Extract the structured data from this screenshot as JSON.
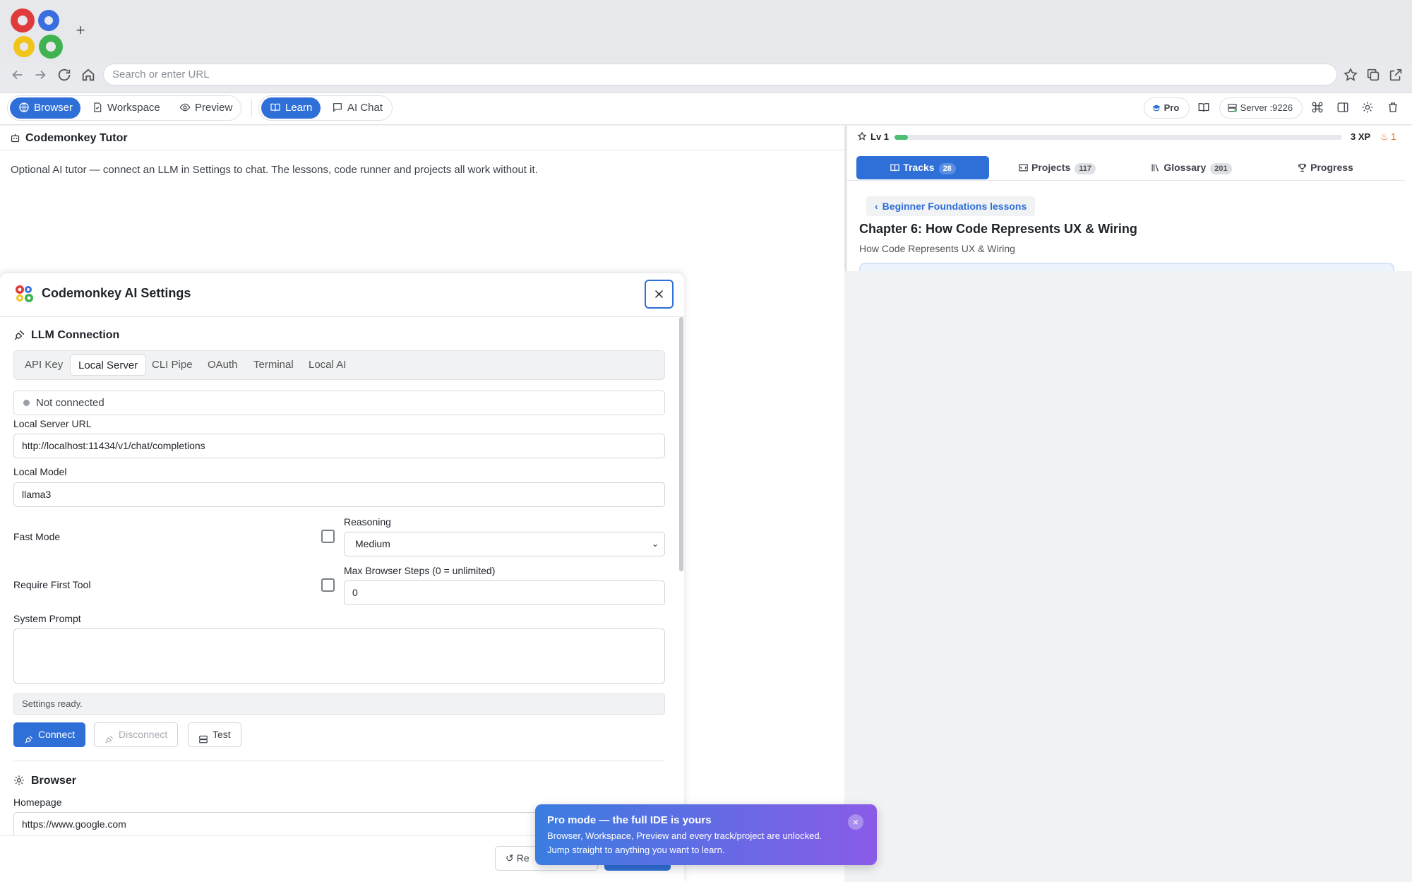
{
  "window": {
    "new_tab": "+"
  },
  "address_bar": {
    "placeholder": "Search or enter URL"
  },
  "toolbar": {
    "modes": [
      "Browser",
      "Workspace",
      "Preview"
    ],
    "learn": "Learn",
    "ai_chat": "AI Chat",
    "pro": "Pro",
    "server": "Server :9226"
  },
  "tutor": {
    "title": "Codemonkey Tutor",
    "text": "Optional AI tutor — connect an LLM in Settings to chat. The lessons, code runner and projects all work without it."
  },
  "progress": {
    "level": "Lv 1",
    "xp_fraction": 0.03,
    "xp": "3 XP",
    "streak": "1"
  },
  "learn_tabs": [
    {
      "label": "Tracks",
      "count": "28"
    },
    {
      "label": "Projects",
      "count": "117"
    },
    {
      "label": "Glossary",
      "count": "201"
    },
    {
      "label": "Progress",
      "count": ""
    }
  ],
  "lesson": {
    "back": "Beginner Foundations lessons",
    "chapter_title": "Chapter 6: How Code Represents UX & Wiring",
    "chapter_subtitle": "How Code Represents UX & Wiring"
  },
  "settings": {
    "title": "Codemonkey AI Settings",
    "llm_heading": "LLM Connection",
    "conn_tabs": [
      "API Key",
      "Local Server",
      "CLI Pipe",
      "OAuth",
      "Terminal",
      "Local AI"
    ],
    "conn_status": "Not connected",
    "server_url_label": "Local Server URL",
    "server_url": "http://localhost:11434/v1/chat/completions",
    "model_label": "Local Model",
    "model": "llama3",
    "fast_mode": "Fast Mode",
    "reasoning_label": "Reasoning",
    "reasoning": "Medium",
    "require_first_tool": "Require First Tool",
    "max_steps_label": "Max Browser Steps (0 = unlimited)",
    "max_steps": "0",
    "system_prompt_label": "System Prompt",
    "system_prompt": "",
    "status_text": "Settings ready.",
    "connect": "Connect",
    "disconnect": "Disconnect",
    "test": "Test",
    "browser_heading": "Browser",
    "homepage_label": "Homepage",
    "homepage": "https://www.google.com",
    "reset_partial": "Re"
  },
  "toast": {
    "title": "Pro mode — the full IDE is yours",
    "body": "Browser, Workspace, Preview and every track/project are unlocked. Jump straight to anything you want to learn.",
    "close": "×"
  },
  "colors": {
    "accent": "#2f6fd8",
    "xp": "#4cbf74",
    "streak": "#e86a1c"
  },
  "icons": [
    "gears-logo-icon",
    "back-arrow-icon",
    "forward-arrow-icon",
    "reload-icon",
    "home-icon",
    "star-icon",
    "copy-icon",
    "external-link-icon",
    "globe-icon",
    "workspace-icon",
    "eye-icon",
    "book-icon",
    "chat-icon",
    "graduation-icon",
    "server-icon",
    "command-icon",
    "sidebar-icon",
    "gear-icon",
    "trash-icon",
    "robot-icon",
    "plug-icon",
    "chevron-left-icon",
    "close-icon"
  ]
}
